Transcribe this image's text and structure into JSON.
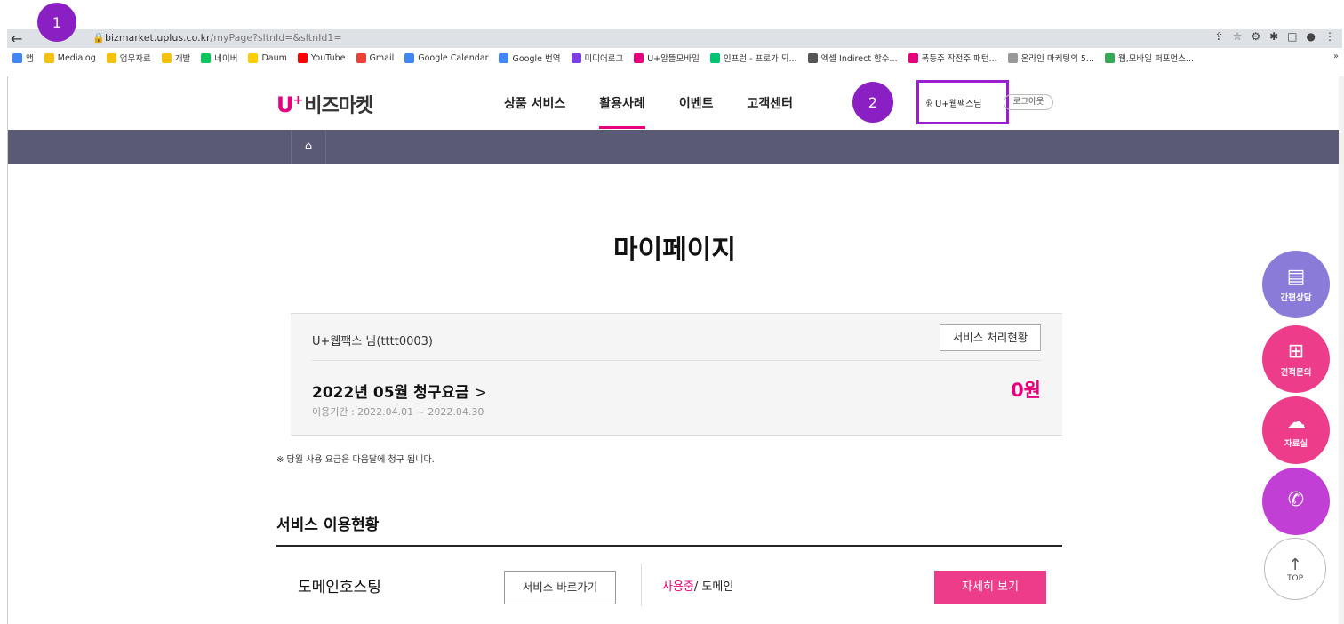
{
  "browser": {
    "url_host": "bizmarket.uplus.co.kr",
    "url_path": "/myPage?sltnId=&sltnId1=",
    "bookmarks": [
      {
        "label": "앱",
        "color": "#4285f4"
      },
      {
        "label": "Medialog",
        "color": "#f4c20d"
      },
      {
        "label": "업무자료",
        "color": "#f4c20d"
      },
      {
        "label": "개발",
        "color": "#f4c20d"
      },
      {
        "label": "네이버",
        "color": "#03c75a"
      },
      {
        "label": "Daum",
        "color": "#ffcd00"
      },
      {
        "label": "YouTube",
        "color": "#ff0000"
      },
      {
        "label": "Gmail",
        "color": "#ea4335"
      },
      {
        "label": "Google Calendar",
        "color": "#4285f4"
      },
      {
        "label": "Google 번역",
        "color": "#4285f4"
      },
      {
        "label": "미디어로그",
        "color": "#7b3fe4"
      },
      {
        "label": "U+알뜰모바일",
        "color": "#e6007e"
      },
      {
        "label": "인프런 - 프로가 되...",
        "color": "#00c471"
      },
      {
        "label": "엑셀 Indirect 함수...",
        "color": "#555555"
      },
      {
        "label": "폭등주 작전주 패턴...",
        "color": "#e6007e"
      },
      {
        "label": "온라인 마케팅의 5...",
        "color": "#999999"
      },
      {
        "label": "웹,모바일 퍼포먼스...",
        "color": "#34a853"
      }
    ],
    "bookmark_more": "»"
  },
  "markers": {
    "one": "1",
    "two": "2"
  },
  "header": {
    "logo_mark": "U",
    "logo_plus": "+",
    "logo_text": "비즈마켓",
    "menu": [
      "상품 서비스",
      "활용사례",
      "이벤트",
      "고객센터"
    ],
    "user_name": "U+웹팩스님",
    "logout": "로그아웃"
  },
  "page": {
    "title": "마이페이지",
    "bill": {
      "user": "U+웹팩스 님(tttt0003)",
      "status_button": "서비스 처리현황",
      "title": "2022년 05월 청구요금",
      "chevron": ">",
      "period": "이용기간 : 2022.04.01 ~ 2022.04.30",
      "amount": "0원"
    },
    "note": "※ 당월 사용 요금은 다음달에 청구 됩니다.",
    "section_title": "서비스 이용현황",
    "service": {
      "name": "도메인호스팅",
      "go_button": "서비스 바로가기",
      "status_on": "사용중",
      "status_rest": "/ 도메인",
      "detail_button": "자세히 보기"
    }
  },
  "floating": [
    {
      "label": "간편상담",
      "color": "#8b7bd8",
      "icon": "chat-doc-icon"
    },
    {
      "label": "견적문의",
      "color": "#ec3c8a",
      "icon": "calculator-icon"
    },
    {
      "label": "자료실",
      "color": "#ec3c8a",
      "icon": "cloud-download-icon"
    },
    {
      "label": "",
      "color": "#c13fd4",
      "icon": "phone-icon"
    }
  ],
  "top_button": "TOP",
  "colors": {
    "brand": "#e6007e",
    "subbar": "#5a5a75",
    "highlight": "#9b1fd0"
  }
}
